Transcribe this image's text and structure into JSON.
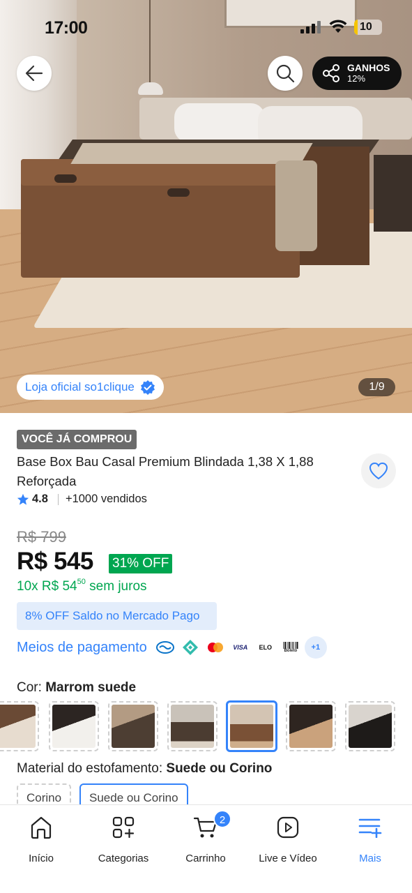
{
  "status_bar": {
    "time": "17:00",
    "battery": "10"
  },
  "hero": {
    "earnings_label": "GANHOS",
    "earnings_pct": "12%",
    "official_store": "Loja oficial so1clique",
    "pager": "1/9"
  },
  "product": {
    "badge": "VOCÊ JÁ COMPROU",
    "title": "Base Box Bau Casal Premium Blindada 1,38 X 1,88  Reforçada",
    "rating": "4.8",
    "sold": "+1000 vendidos",
    "old_price": "R$ 799",
    "price": "R$ 545",
    "discount": "31% OFF",
    "installments_prefix": "10x R$ 54",
    "installments_cents": "50",
    "installments_suffix": "sem juros",
    "promo": "8% OFF Saldo no Mercado Pago",
    "payment_label": "Meios de pagamento",
    "payment_methods": [
      "mercado-pago-icon",
      "pix-icon",
      "mastercard-icon",
      "visa-icon",
      "elo-icon",
      "boleto-icon"
    ],
    "payment_visa": "VISA",
    "payment_elo": "ELO",
    "payment_boleto": "Boleto",
    "payment_more": "+1",
    "color_label": "Cor:",
    "color_value": "Marrom suede",
    "material_label": "Material do estofamento:",
    "material_value": "Suede ou Corino",
    "material_options": [
      "Corino",
      "Suede ou Corino"
    ],
    "selected_color_index": 4
  },
  "nav": {
    "items": [
      {
        "label": "Início",
        "icon": "home-icon"
      },
      {
        "label": "Categorias",
        "icon": "categories-icon"
      },
      {
        "label": "Carrinho",
        "icon": "cart-icon",
        "badge": "2"
      },
      {
        "label": "Live e Vídeo",
        "icon": "play-icon"
      },
      {
        "label": "Mais",
        "icon": "menu-plus-icon"
      }
    ]
  },
  "colors": {
    "accent": "#3483fa",
    "green": "#00a650"
  }
}
